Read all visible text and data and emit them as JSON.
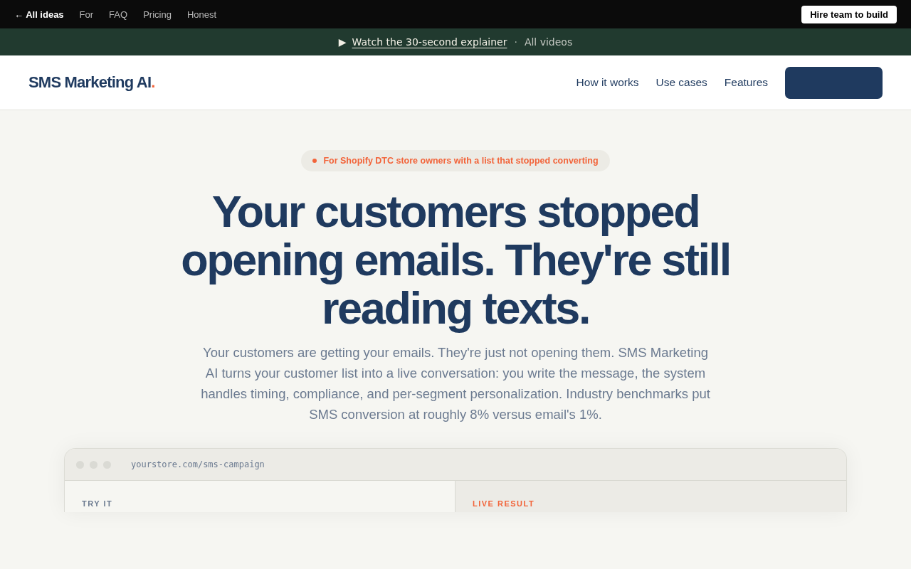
{
  "top_bar": {
    "back_link": "← All ideas",
    "links": [
      "For",
      "FAQ",
      "Pricing",
      "Honest"
    ],
    "cta": "Hire team to build"
  },
  "banner": {
    "play": "▶",
    "link": "Watch the 30-second explainer",
    "separator": "·",
    "all_videos": "All videos"
  },
  "header": {
    "logo": "SMS Marketing AI",
    "logo_dot": ".",
    "nav": [
      "How it works",
      "Use cases",
      "Features"
    ]
  },
  "hero": {
    "badge": "For Shopify DTC store owners with a list that stopped converting",
    "headline": "Your customers stopped opening emails. They're still reading texts.",
    "paragraph": "Your customers are getting your emails. They're just not opening them. SMS Marketing AI turns your customer list into a live conversation: you write the message, the system handles timing, compliance, and per-segment personalization. Industry benchmarks put SMS conversion at roughly 8% versus email's 1%."
  },
  "demo": {
    "url": "yourstore.com/sms-campaign",
    "left_label": "TRY IT",
    "right_label": "LIVE RESULT"
  }
}
